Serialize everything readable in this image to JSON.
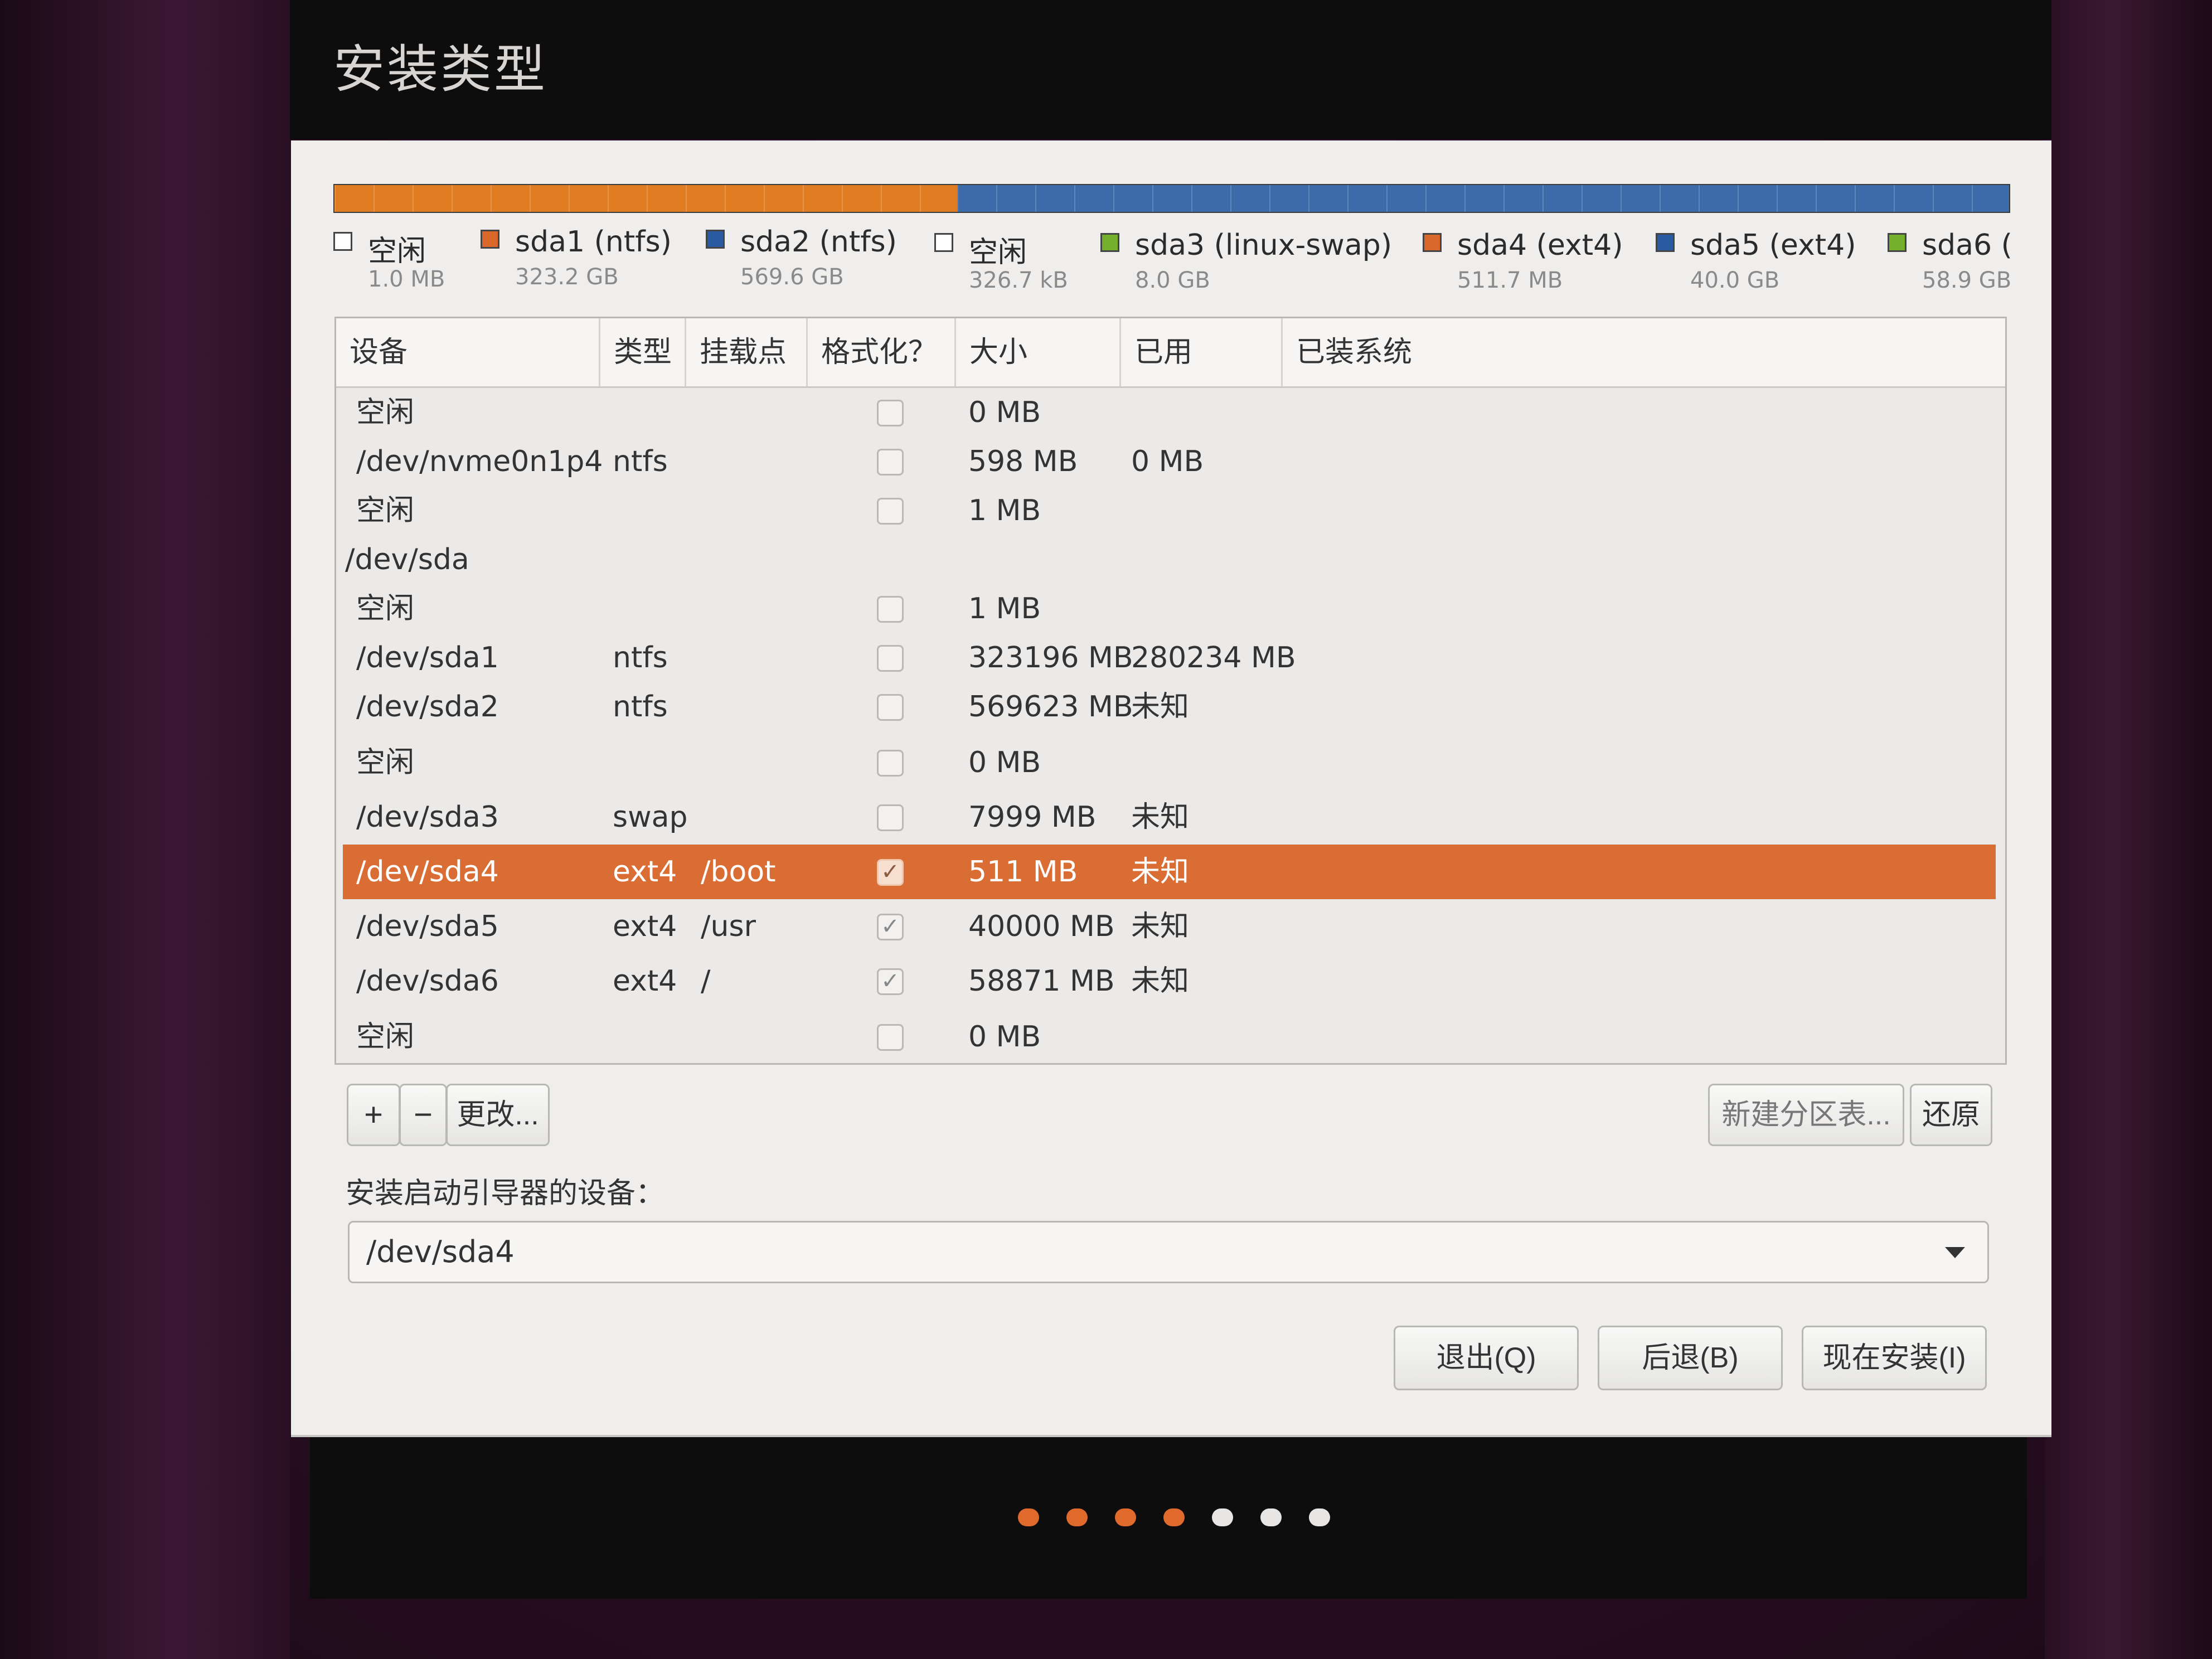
{
  "window": {
    "title": "安装类型"
  },
  "partition_bar": {
    "segments": [
      {
        "color": "#e07c22",
        "fraction": 0.372,
        "style": "striped"
      },
      {
        "color": "#3d6aa8",
        "fraction": 0.628,
        "style": "striped"
      }
    ]
  },
  "legend": [
    {
      "name": "空闲",
      "size": "1.0 MB",
      "color": "#ffffff"
    },
    {
      "name": "sda1 (ntfs)",
      "size": "323.2 GB",
      "color": "#d9682c"
    },
    {
      "name": "sda2 (ntfs)",
      "size": "569.6 GB",
      "color": "#2a5aa0"
    },
    {
      "name": "空闲",
      "size": "326.7 kB",
      "color": "#ffffff"
    },
    {
      "name": "sda3 (linux-swap)",
      "size": "8.0 GB",
      "color": "#74b02c"
    },
    {
      "name": "sda4 (ext4)",
      "size": "511.7 MB",
      "color": "#d9682c"
    },
    {
      "name": "sda5 (ext4)",
      "size": "40.0 GB",
      "color": "#2a5aa0"
    },
    {
      "name": "sda6 (",
      "size": "58.9 GB",
      "color": "#74b02c"
    }
  ],
  "table": {
    "headers": [
      "设备",
      "类型",
      "挂载点",
      "格式化？",
      "大小",
      "已用",
      "已装系统"
    ],
    "rows": [
      {
        "device": "空闲",
        "type": "",
        "mount": "",
        "format": false,
        "size": "0 MB",
        "used": "",
        "indent": 1
      },
      {
        "device": "/dev/nvme0n1p4",
        "type": "ntfs",
        "mount": "",
        "format": false,
        "size": "598 MB",
        "used": "0 MB",
        "indent": 1
      },
      {
        "device": "空闲",
        "type": "",
        "mount": "",
        "format": false,
        "size": "1 MB",
        "used": "",
        "indent": 1
      },
      {
        "device": "/dev/sda",
        "type": "",
        "mount": "",
        "format": null,
        "size": "",
        "used": "",
        "indent": 0
      },
      {
        "device": "空闲",
        "type": "",
        "mount": "",
        "format": false,
        "size": "1 MB",
        "used": "",
        "indent": 1
      },
      {
        "device": "/dev/sda1",
        "type": "ntfs",
        "mount": "",
        "format": false,
        "size": "323196 MB",
        "used": "280234 MB",
        "indent": 1
      },
      {
        "device": "/dev/sda2",
        "type": "ntfs",
        "mount": "",
        "format": false,
        "size": "569623 MB",
        "used": "未知",
        "indent": 1
      },
      {
        "device": "空闲",
        "type": "",
        "mount": "",
        "format": false,
        "size": "0 MB",
        "used": "",
        "indent": 1
      },
      {
        "device": "/dev/sda3",
        "type": "swap",
        "mount": "",
        "format": false,
        "size": "7999 MB",
        "used": "未知",
        "indent": 1
      },
      {
        "device": "/dev/sda4",
        "type": "ext4",
        "mount": "/boot",
        "format": true,
        "size": "511 MB",
        "used": "未知",
        "indent": 1,
        "selected": true
      },
      {
        "device": "/dev/sda5",
        "type": "ext4",
        "mount": "/usr",
        "format": true,
        "size": "40000 MB",
        "used": "未知",
        "indent": 1
      },
      {
        "device": "/dev/sda6",
        "type": "ext4",
        "mount": "/",
        "format": true,
        "size": "58871 MB",
        "used": "未知",
        "indent": 1
      },
      {
        "device": "空闲",
        "type": "",
        "mount": "",
        "format": false,
        "size": "0 MB",
        "used": "",
        "indent": 1
      }
    ]
  },
  "toolbar": {
    "add": "+",
    "remove": "−",
    "change": "更改...",
    "new_table": "新建分区表...",
    "revert": "还原"
  },
  "bootloader": {
    "label": "安装启动引导器的设备：",
    "value": "/dev/sda4"
  },
  "actions": {
    "quit": "退出(Q)",
    "back": "后退(B)",
    "install": "现在安装(I)"
  },
  "progress_dots": {
    "total": 7,
    "active": 4,
    "active_color": "#e06a2c",
    "inactive_color": "#e8e6e4"
  }
}
